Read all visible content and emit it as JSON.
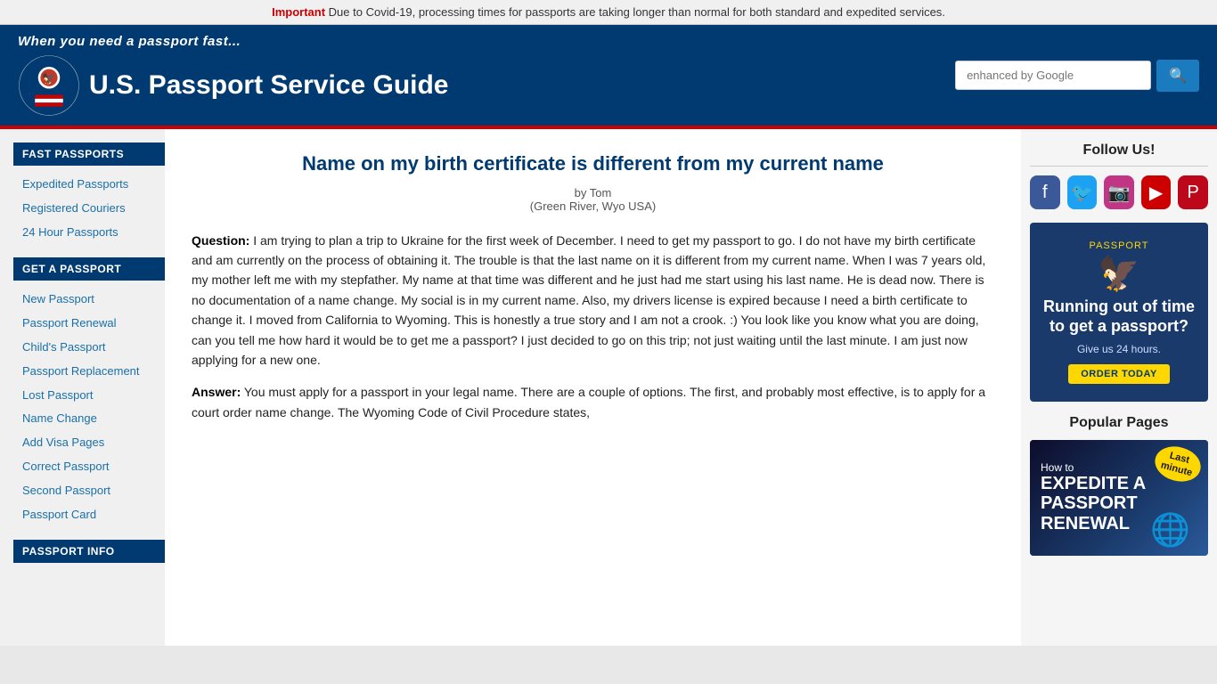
{
  "alert": {
    "prefix": "Important",
    "message": " Due to Covid-19, processing times for passports are taking longer than normal for both standard and expedited services."
  },
  "header": {
    "tagline": "When you need a passport fast...",
    "logo_text": "U.S. Passport Service Guide",
    "search_placeholder": "enhanced by Google",
    "search_button_label": "🔍"
  },
  "sidebar": {
    "fast_passports_title": "FAST PASSPORTS",
    "fast_passports_links": [
      "Expedited Passports",
      "Registered Couriers",
      "24 Hour Passports"
    ],
    "get_passport_title": "GET A PASSPORT",
    "get_passport_links": [
      "New Passport",
      "Passport Renewal",
      "Child's Passport",
      "Passport Replacement",
      "Lost Passport",
      "Name Change",
      "Add Visa Pages",
      "Correct Passport",
      "Second Passport",
      "Passport Card"
    ],
    "passport_info_title": "PASSPORT INFO"
  },
  "article": {
    "title": "Name on my birth certificate is different from my current name",
    "byline_author": "by Tom",
    "byline_location": "(Green River, Wyo USA)",
    "question_label": "Question:",
    "question_text": " I am trying to plan a trip to Ukraine for the first week of December. I need to get my passport to go. I do not have my birth certificate and am currently on the process of obtaining it. The trouble is that the last name on it is different from my current name. When I was 7 years old, my mother left me with my stepfather. My name at that time was different and he just had me start using his last name. He is dead now. There is no documentation of a name change. My social is in my current name. Also, my drivers license is expired because I need a birth certificate to change it. I moved from California to Wyoming. This is honestly a true story and I am not a crook. :) You look like you know what you are doing, can you tell me how hard it would be to get me a passport? I just decided to go on this trip; not just waiting until the last minute. I am just now applying for a new one.",
    "answer_label": "Answer:",
    "answer_text": " You must apply for a passport in your legal name. There are a couple of options. The first, and probably most effective, is to apply for a court order name change. The Wyoming Code of Civil Procedure states,"
  },
  "right_sidebar": {
    "follow_us_title": "Follow Us!",
    "social_links": [
      "facebook",
      "twitter",
      "instagram",
      "youtube",
      "pinterest"
    ],
    "ad_passport_label": "PASSPORT",
    "ad_headline": "Running out of time to get a passport?",
    "ad_sub": "Give us 24 hours.",
    "ad_cta": "ORDER TODAY",
    "popular_pages_title": "Popular Pages",
    "popular_img_how": "How to",
    "popular_img_expedite": "EXPEDITE A",
    "popular_img_passport": "PASSPORT",
    "popular_img_renewal": "RENEWAL",
    "popular_img_badge": "Last\nminute"
  }
}
